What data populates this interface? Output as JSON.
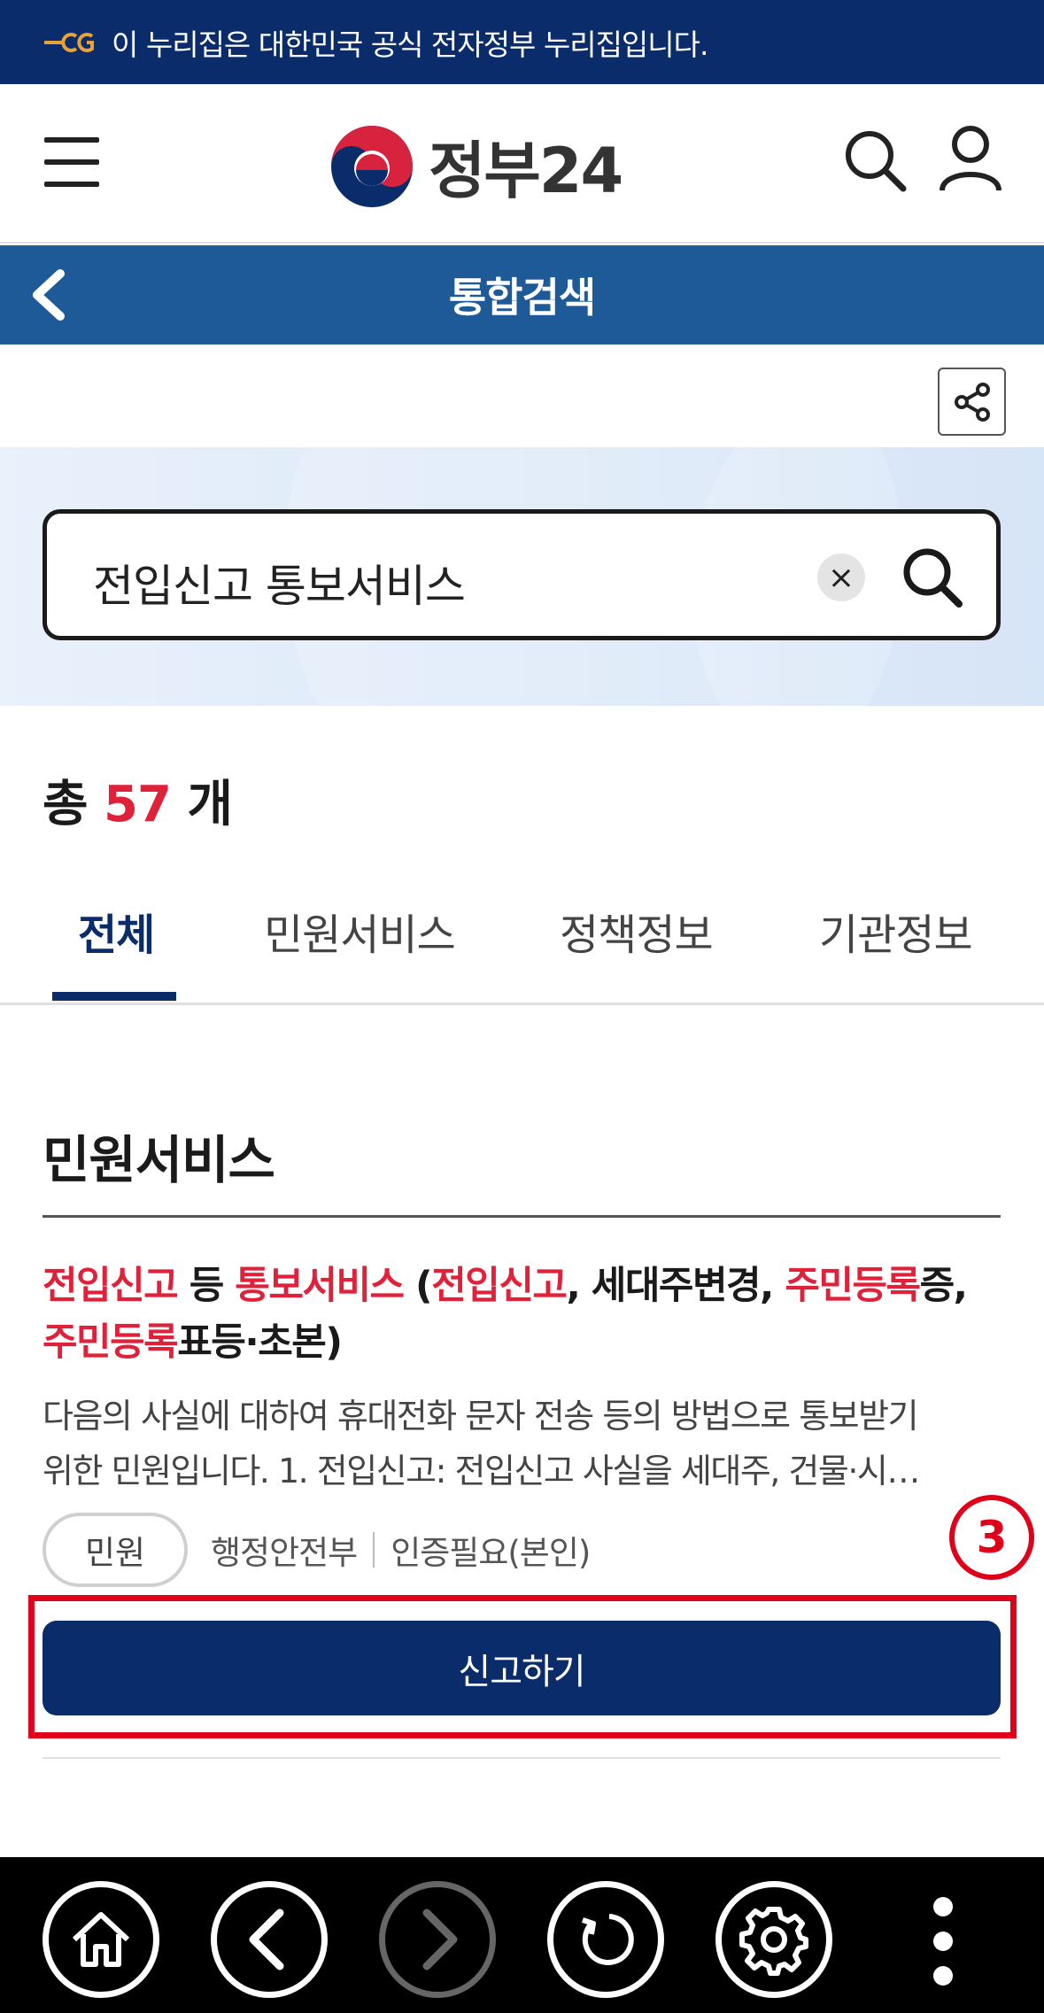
{
  "gov_banner": {
    "text": "이 누리집은 대한민국 공식 전자정부 누리집입니다."
  },
  "header": {
    "logo_text": "정부24"
  },
  "titlebar": {
    "title": "통합검색"
  },
  "search": {
    "query": "전입신고 통보서비스",
    "clear_symbol": "×"
  },
  "results": {
    "total_prefix": "총",
    "total_count": "57",
    "total_suffix": "개"
  },
  "tabs": [
    {
      "label": "전체",
      "active": true
    },
    {
      "label": "민원서비스",
      "active": false
    },
    {
      "label": "정책정보",
      "active": false
    },
    {
      "label": "기관정보",
      "active": false
    }
  ],
  "section": {
    "title": "민원서비스"
  },
  "item": {
    "title_parts": [
      {
        "text": "전입신고",
        "hl": true
      },
      {
        "text": " 등 ",
        "hl": false
      },
      {
        "text": "통보서비스",
        "hl": true
      },
      {
        "text": " (",
        "hl": false
      },
      {
        "text": "전입신고",
        "hl": true
      },
      {
        "text": ", 세대주변경, ",
        "hl": false
      },
      {
        "text": "주민등록",
        "hl": true
      },
      {
        "text": "증, ",
        "hl": false
      },
      {
        "text": "주민등록",
        "hl": true
      },
      {
        "text": "표등·초본)",
        "hl": false
      }
    ],
    "desc_line1": "다음의 사실에 대하여 휴대전화 문자 전송 등의 방법으로 통보받기",
    "desc_line2": "위한 민원입니다. 1. 전입신고: 전입신고 사실을 세대주, 건물·시…",
    "badge": "민원",
    "org": "행정안전부",
    "auth": "인증필요(본인)",
    "button_label": "신고하기"
  },
  "annotation": {
    "step_number": "3",
    "color": "#e0001a"
  },
  "colors": {
    "navy": "#0b2c6b",
    "title_blue": "#1e5a98",
    "highlight_red": "#e0213a"
  },
  "bottom_nav": [
    {
      "icon": "home-icon"
    },
    {
      "icon": "back-arrow-icon"
    },
    {
      "icon": "forward-arrow-icon",
      "disabled": true
    },
    {
      "icon": "refresh-icon"
    },
    {
      "icon": "settings-gear-icon"
    },
    {
      "icon": "more-vertical-icon"
    }
  ]
}
